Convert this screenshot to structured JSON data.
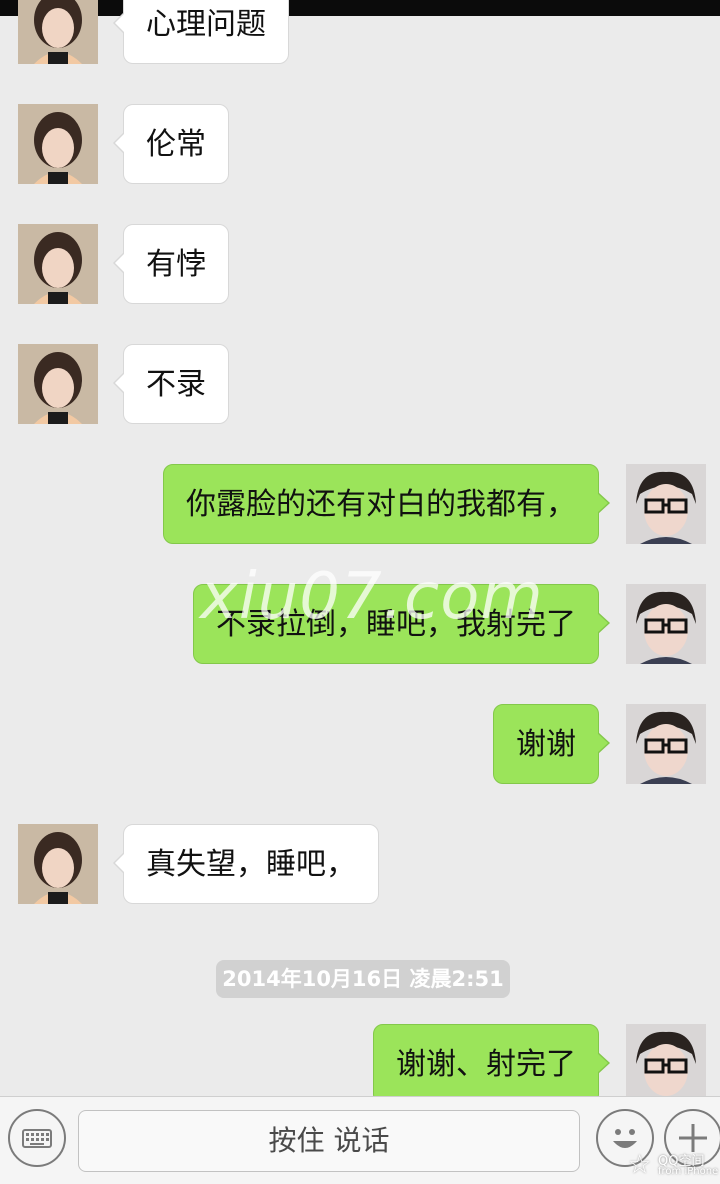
{
  "messages": [
    {
      "text": "心理问题"
    },
    {
      "text": "伦常"
    },
    {
      "text": "有悖"
    },
    {
      "text": "不录"
    },
    {
      "text": "你露脸的还有对白的我都有，"
    },
    {
      "text": "不录拉倒，睡吧，我射完了"
    },
    {
      "text": "谢谢"
    },
    {
      "text": "真失望，睡吧，"
    },
    {
      "text": "谢谢、射完了"
    }
  ],
  "timestamp": "2014年10月16日 凌晨2:51",
  "watermark": "xiu07.com",
  "input_bar": {
    "voice_button_label": "按住 说话",
    "left_icon": "keyboard-icon",
    "emoji_icon": "emoji-icon",
    "plus_icon": "plus-icon"
  },
  "qq_watermark": {
    "line1": "QQ空间",
    "line2": "from iPhone"
  },
  "colors": {
    "incoming_bubble": "#ffffff",
    "outgoing_bubble": "#9be45a",
    "background": "#ebebeb"
  }
}
